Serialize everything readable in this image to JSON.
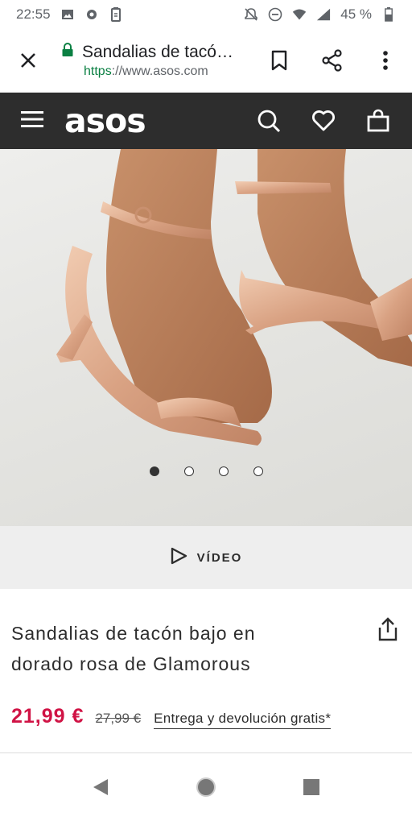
{
  "status_bar": {
    "time": "22:55",
    "battery": "45 %",
    "icons": [
      "image-icon",
      "cast-icon",
      "battery-saver-icon",
      "mute-icon",
      "dnd-icon",
      "wifi-icon",
      "signal-icon",
      "battery-icon"
    ]
  },
  "browser": {
    "page_title": "Sandalias de tacó…",
    "url_scheme": "https",
    "url_rest": "://www.asos.com",
    "actions": [
      "bookmark-icon",
      "share-icon",
      "more-icon"
    ]
  },
  "site_header": {
    "logo": "asos",
    "actions": [
      "search-icon",
      "heart-icon",
      "bag-icon"
    ]
  },
  "gallery": {
    "image_count": 4,
    "active_index": 0
  },
  "video": {
    "label": "VÍDEO"
  },
  "product": {
    "name": "Sandalias de tacón bajo en dorado rosa de Glamorous",
    "price_now": "21,99 €",
    "price_old": "27,99 €",
    "delivery": "Entrega y devolución gratis*"
  },
  "colors": {
    "header_bg": "#2d2d2d",
    "sale_price": "#d01345",
    "secure_green": "#0b8043"
  }
}
